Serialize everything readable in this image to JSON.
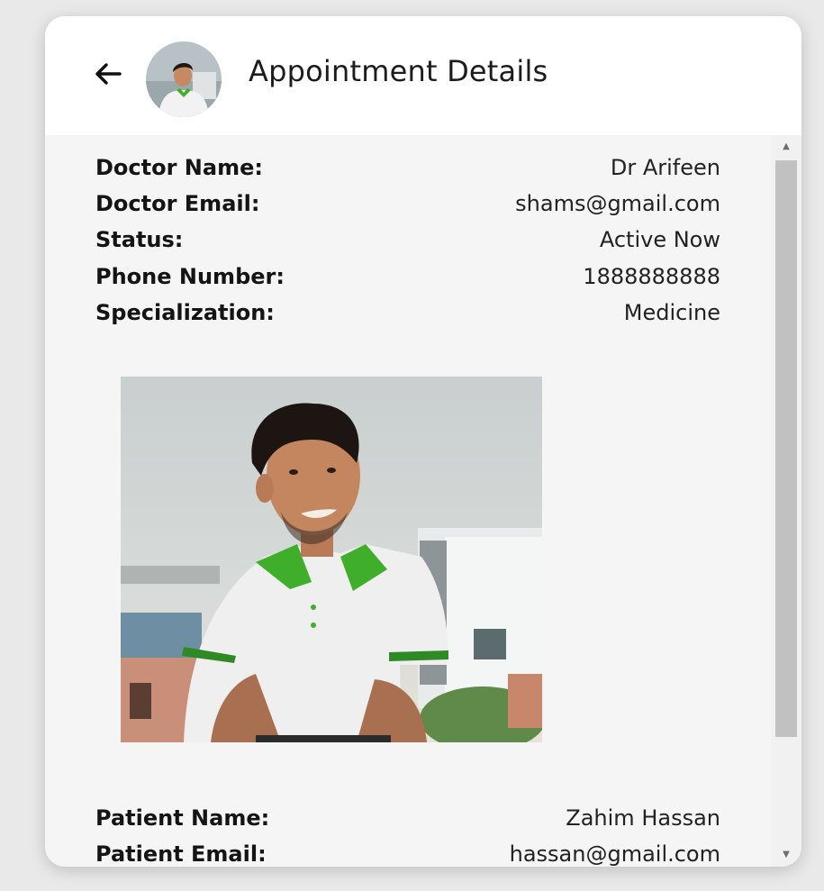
{
  "header": {
    "title": "Appointment Details",
    "back_icon": "arrow-left-icon",
    "avatar_icon": "user-avatar"
  },
  "doctor": {
    "name_label": "Doctor Name:",
    "name": "Dr Arifeen",
    "email_label": "Doctor Email:",
    "email": "shams@gmail.com",
    "status_label": "Status:",
    "status": "Active Now",
    "phone_label": "Phone Number:",
    "phone": "1888888888",
    "specialization_label": "Specialization:",
    "specialization": "Medicine"
  },
  "patient": {
    "name_label": "Patient Name:",
    "name": "Zahim Hassan",
    "email_label": "Patient Email:",
    "email": "hassan@gmail.com"
  },
  "colors": {
    "background": "#e9e9e9",
    "card": "#f5f5f5",
    "header": "#ffffff",
    "shirt_collar": "#3fae2a"
  }
}
